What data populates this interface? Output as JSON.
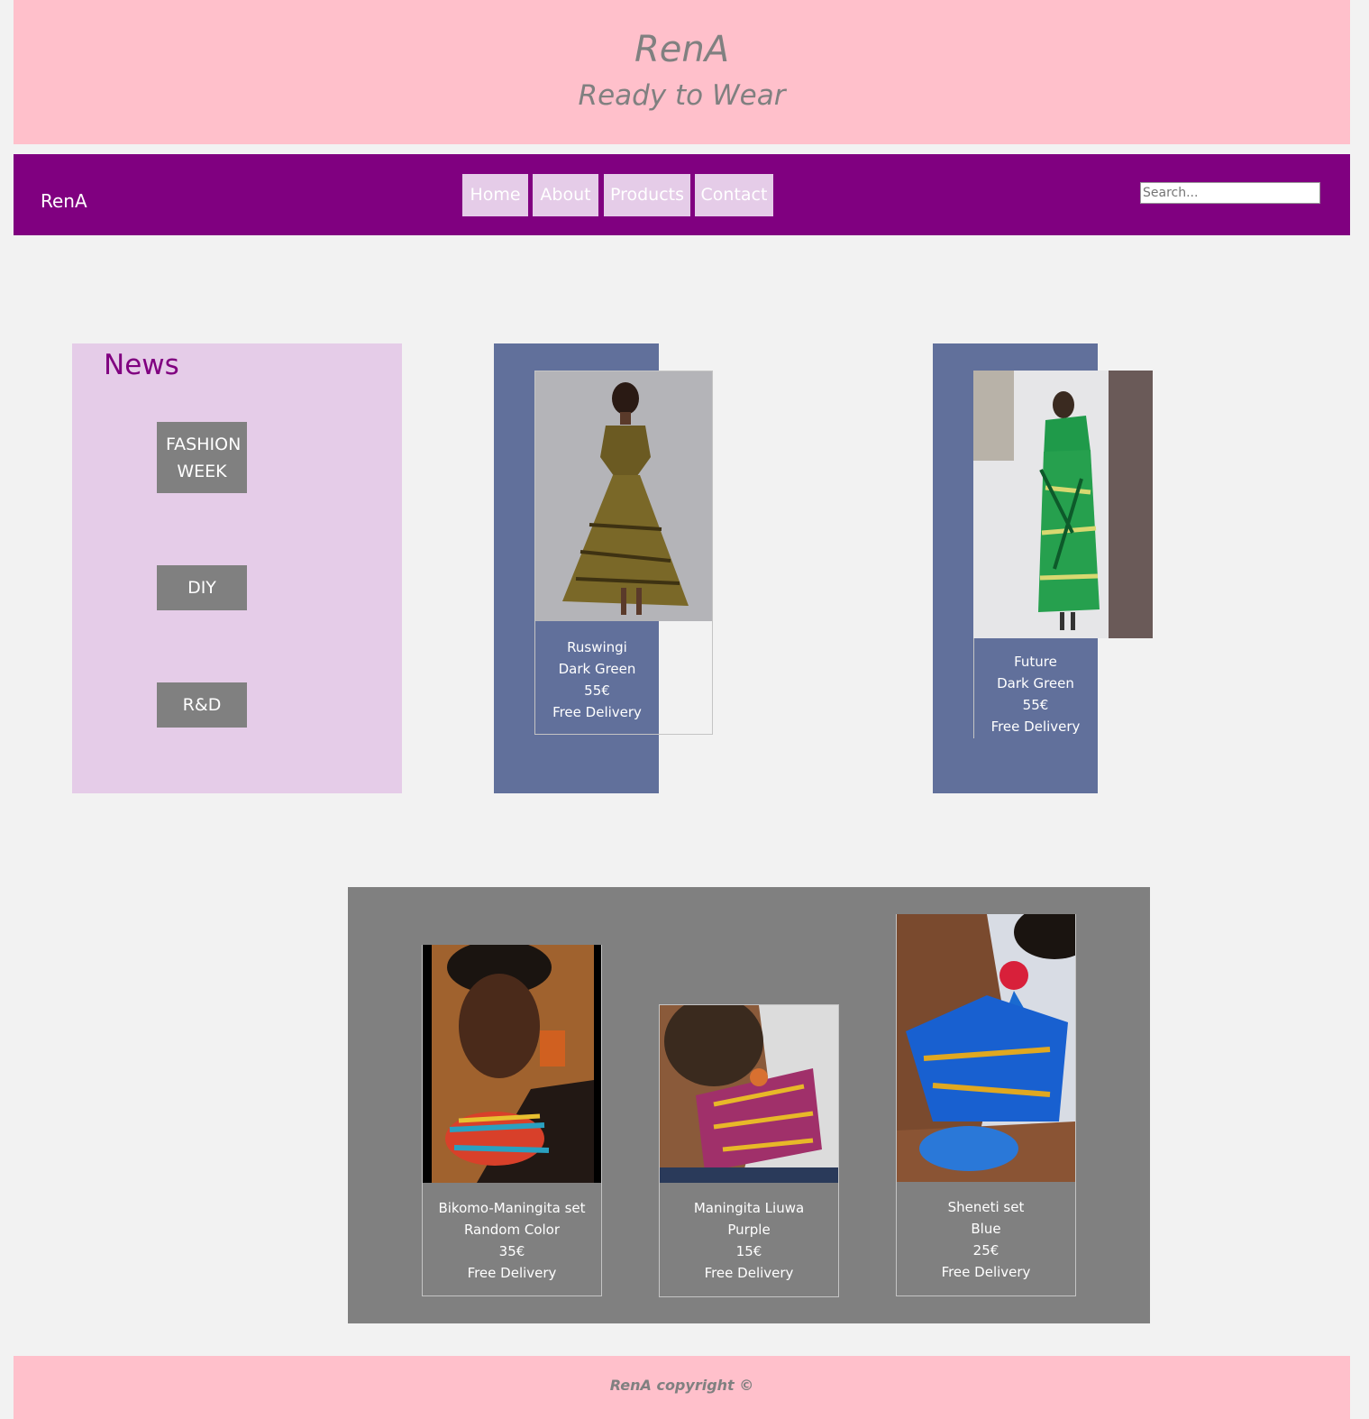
{
  "header": {
    "title": "RenA",
    "subtitle": "Ready to Wear"
  },
  "nav": {
    "brand": "RenA",
    "links": [
      "Home",
      "About",
      "Products",
      "Contact"
    ],
    "search_placeholder": "Search..."
  },
  "news": {
    "title": "News",
    "buttons": [
      "FASHION WEEK",
      "DIY",
      "R&D"
    ]
  },
  "dresses": [
    {
      "name": "Ruswingi",
      "color": "Dark Green",
      "price": "55€",
      "delivery": "Free Delivery"
    },
    {
      "name": "Future",
      "color": "Dark Green",
      "price": "55€",
      "delivery": "Free Delivery"
    }
  ],
  "accessories": [
    {
      "name": "Bikomo-Maningita set",
      "color": "Random Color",
      "price": "35€",
      "delivery": "Free Delivery"
    },
    {
      "name": "Maningita Liuwa",
      "color": "Purple",
      "price": "15€",
      "delivery": "Free Delivery"
    },
    {
      "name": "Sheneti set",
      "color": "Blue",
      "price": "25€",
      "delivery": "Free Delivery"
    }
  ],
  "footer": {
    "text": "RenA copyright ©"
  },
  "colors": {
    "header_bg": "#ffc0cb",
    "nav_bg": "#800080",
    "news_bg": "#e5cce8",
    "card_bg": "#61709b",
    "accessories_bg": "#808080"
  }
}
